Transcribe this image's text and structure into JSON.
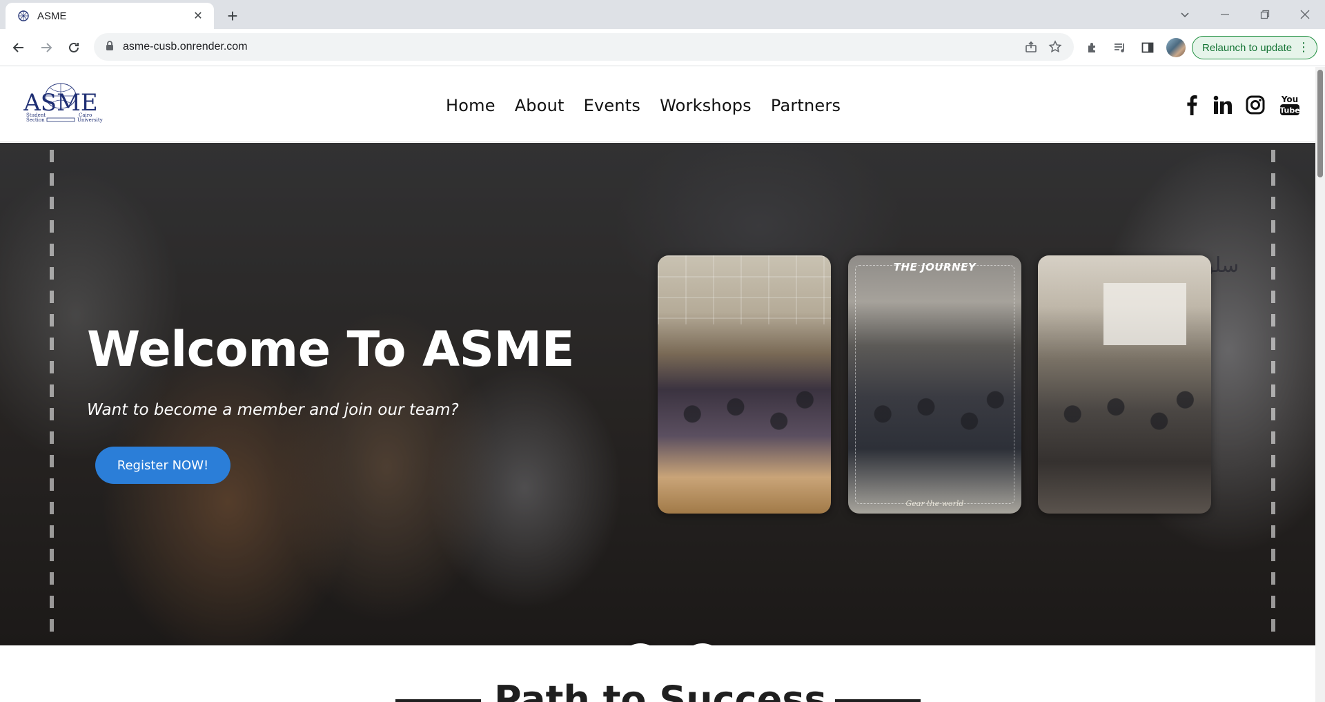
{
  "browser": {
    "tab": {
      "title": "ASME",
      "favicon": "asme-favicon-icon",
      "close_glyph": "✕"
    },
    "new_tab_glyph": "+",
    "url": "asme-cusb.onrender.com",
    "relaunch_label": "Relaunch to update",
    "icons": [
      "back-icon",
      "forward-icon",
      "reload-icon",
      "lock-icon",
      "share-icon",
      "bookmark-star-icon",
      "extensions-icon",
      "media-icon",
      "side-panel-icon",
      "profile-avatar",
      "menu-dots-icon"
    ]
  },
  "site": {
    "logo": {
      "name": "ASME",
      "left_text": [
        "Student",
        "Section"
      ],
      "right_text": [
        "Cairo",
        "University"
      ]
    },
    "nav": [
      {
        "label": "Home"
      },
      {
        "label": "About"
      },
      {
        "label": "Events"
      },
      {
        "label": "Workshops"
      },
      {
        "label": "Partners"
      }
    ],
    "social": [
      "facebook-icon",
      "linkedin-icon",
      "instagram-icon",
      "youtube-icon"
    ],
    "youtube_text": [
      "You",
      "Tube"
    ]
  },
  "hero": {
    "title": "Welcome To ASME",
    "subtitle": "Want to become a member and join our team?",
    "cta": "Register NOW!",
    "cards": [
      {
        "caption": ""
      },
      {
        "caption": "THE JOURNEY",
        "footer": "Gear the world"
      },
      {
        "caption": ""
      }
    ],
    "arabic_banner": "سلوك",
    "carousel_prev_icon": "chevron-left-icon",
    "carousel_next_icon": "chevron-right-icon"
  },
  "section": {
    "heading": "Path to Success"
  },
  "colors": {
    "accent_blue": "#2b7ed8",
    "relaunch_green": "#137333"
  }
}
